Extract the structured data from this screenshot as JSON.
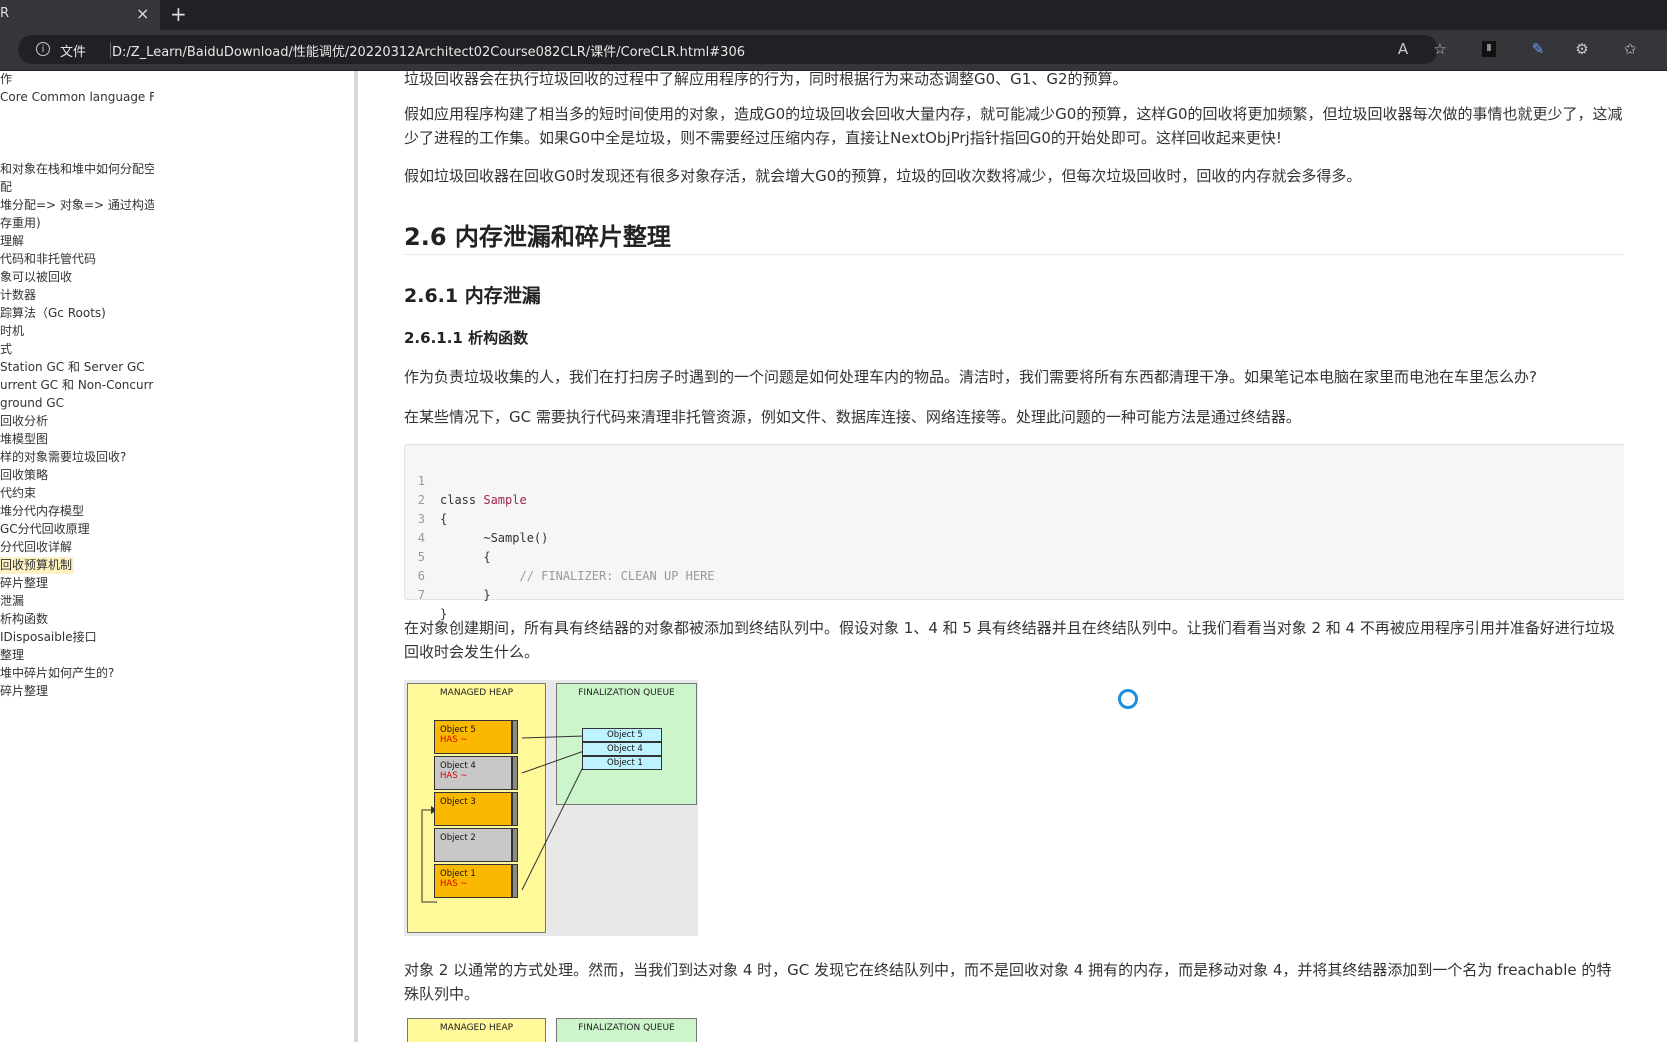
{
  "browser": {
    "tab_title": "R",
    "tab_close": "×",
    "new_tab": "+",
    "address_info": "文件",
    "url": "D:/Z_Learn/BaiduDownload/性能调优/20220312Architect02Course082CLR/课件/CoreCLR.html#306",
    "icons": [
      "read-aloud-icon",
      "favorite-add-icon",
      "extension-icon",
      "pen-icon",
      "puzzle-icon",
      "favorites-icon"
    ]
  },
  "sidebar": {
    "items": [
      {
        "label": "作",
        "active": false
      },
      {
        "label": "Core Common language F",
        "active": false
      },
      {
        "label": "",
        "active": false
      },
      {
        "label": "",
        "active": false
      },
      {
        "label": "",
        "active": false
      },
      {
        "label": "和对象在栈和堆中如何分配空间",
        "active": false
      },
      {
        "label": "配",
        "active": false
      },
      {
        "label": "堆分配=> 对象=> 通过构造函",
        "active": false
      },
      {
        "label": "存重用)",
        "active": false
      },
      {
        "label": "理解",
        "active": false
      },
      {
        "label": "代码和非托管代码",
        "active": false
      },
      {
        "label": "象可以被回收",
        "active": false
      },
      {
        "label": "计数器",
        "active": false
      },
      {
        "label": "踪算法（Gc Roots)",
        "active": false
      },
      {
        "label": "时机",
        "active": false
      },
      {
        "label": "式",
        "active": false
      },
      {
        "label": "Station GC 和 Server GC",
        "active": false
      },
      {
        "label": "urrent GC 和 Non-Concurr",
        "active": false
      },
      {
        "label": "ground GC",
        "active": false
      },
      {
        "label": "回收分析",
        "active": false
      },
      {
        "label": "堆模型图",
        "active": false
      },
      {
        "label": "样的对象需要垃圾回收?",
        "active": false
      },
      {
        "label": "回收策略",
        "active": false
      },
      {
        "label": "代约束",
        "active": false
      },
      {
        "label": "堆分代内存模型",
        "active": false
      },
      {
        "label": "GC分代回收原理",
        "active": false
      },
      {
        "label": "分代回收详解",
        "active": false
      },
      {
        "label": "回收预算机制",
        "active": true
      },
      {
        "label": "碎片整理",
        "active": false
      },
      {
        "label": "泄漏",
        "active": false
      },
      {
        "label": "析构函数",
        "active": false
      },
      {
        "label": "IDisposaible接口",
        "active": false
      },
      {
        "label": "整理",
        "active": false
      },
      {
        "label": "堆中碎片如何产生的?",
        "active": false
      },
      {
        "label": "碎片整理",
        "active": false
      }
    ],
    "scroll_arrow": "▸"
  },
  "content": {
    "p_top": "垃圾回收器会在执行垃圾回收的过程中了解应用程序的行为，同时根据行为来动态调整G0、G1、G2的预算。",
    "p1": "假如应用程序构建了相当多的短时间使用的对象，造成G0的垃圾回收会回收大量内存，就可能减少G0的预算，这样G0的回收将更加频繁，但垃圾回收器每次做的事情也就更少了，这减少了进程的工作集。如果G0中全是垃圾，则不需要经过压缩内存，直接让NextObjPrj指针指回G0的开始处即可。这样回收起来更快!",
    "p2": "假如垃圾回收器在回收G0时发现还有很多对象存活，就会增大G0的预算，垃圾的回收次数将减少，但每次垃圾回收时，回收的内存就会多得多。",
    "h2": "2.6 内存泄漏和碎片整理",
    "h3": "2.6.1 内存泄漏",
    "h4": "2.6.1.1 析构函数",
    "p3": "作为负责垃圾收集的人，我们在打扫房子时遇到的一个问题是如何处理车内的物品。清洁时，我们需要将所有东西都清理干净。如果笔记本电脑在家里而电池在车里怎么办?",
    "p4": "在某些情况下，GC 需要执行代码来清理非托管资源，例如文件、数据库连接、网络连接等。处理此问题的一种可能方法是通过终结器。",
    "code": {
      "line_numbers": [
        "1",
        "2",
        "3",
        "4",
        "5",
        "6",
        "7"
      ],
      "class_kw": "class ",
      "class_name": "Sample",
      "l2": "{",
      "l3": "      ~Sample()",
      "l4": "      {",
      "l5": "           // FINALIZER: CLEAN UP HERE",
      "l6": "      }",
      "l7": "}"
    },
    "p5": "在对象创建期间，所有具有终结器的对象都被添加到终结队列中。假设对象 1、4 和 5 具有终结器并且在终结队列中。让我们看看当对象 2 和 4 不再被应用程序引用并准备好进行垃圾回收时会发生什么。",
    "diagram": {
      "heap_title": "MANAGED HEAP",
      "queue_title": "FINALIZATION QUEUE",
      "has_label": "HAS ~",
      "heap_objects": [
        {
          "label": "Object 5",
          "has_finalizer": true,
          "color": "#fbb800"
        },
        {
          "label": "Object 4",
          "has_finalizer": true,
          "color": "#c8c8c8"
        },
        {
          "label": "Object 3",
          "has_finalizer": false,
          "color": "#fbb800"
        },
        {
          "label": "Object 2",
          "has_finalizer": false,
          "color": "#c8c8c8"
        },
        {
          "label": "Object 1",
          "has_finalizer": true,
          "color": "#fbb800"
        }
      ],
      "queue_objects": [
        "Object 5",
        "Object 4",
        "Object 1"
      ]
    },
    "p6": "对象 2 以通常的方式处理。然而，当我们到达对象 4 时，GC 发现它在终结队列中，而不是回收对象 4 拥有的内存，而是移动对象 4，并将其终结器添加到一个名为 freachable 的特殊队列中。",
    "diagram2": {
      "heap_title": "MANAGED HEAP",
      "queue_title": "FINALIZATION QUEUE"
    }
  }
}
